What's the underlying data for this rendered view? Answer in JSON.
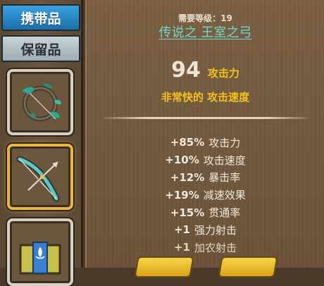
{
  "tabs": {
    "carried": "携带品",
    "stored": "保留品"
  },
  "slots": [
    {
      "icon": "bow-with-vines-icon"
    },
    {
      "icon": "royal-bow-icon",
      "selected": true
    },
    {
      "icon": "fleur-de-lis-banner-icon"
    }
  ],
  "item": {
    "required_level_label": "需要等级：19",
    "name": "传说之 王室之弓",
    "attack_value": "94",
    "attack_label": "攻击力",
    "speed_label": "非常快的 攻击速度"
  },
  "stats": [
    {
      "value": "+85%",
      "label": "攻击力"
    },
    {
      "value": "+10%",
      "label": "攻击速度"
    },
    {
      "value": "+12%",
      "label": "暴击率"
    },
    {
      "value": "+19%",
      "label": "减速效果"
    },
    {
      "value": "+15%",
      "label": "贯通率"
    },
    {
      "value": "+1",
      "label": "强力射击"
    },
    {
      "value": "+1",
      "label": "加农射击"
    }
  ],
  "colors": {
    "item_name": "#6fd8c9",
    "highlight_yellow": "#f2c21a",
    "active_tab": "#2b8ccd",
    "button_yellow": "#f2c631"
  }
}
